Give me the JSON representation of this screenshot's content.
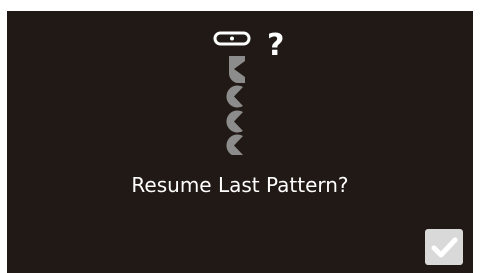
{
  "dialog": {
    "message": "Resume Last Pattern?",
    "question_symbol": "?",
    "illustration_icon": "embroidery-stitch-sequence-icon",
    "confirm_icon": "checkmark-icon"
  },
  "colors": {
    "screen_background": "#211915",
    "text": "#ffffff",
    "icon": "#ffffff",
    "stitch_shape": "#8c8c8c",
    "confirm_button": "#d9d9d9"
  }
}
